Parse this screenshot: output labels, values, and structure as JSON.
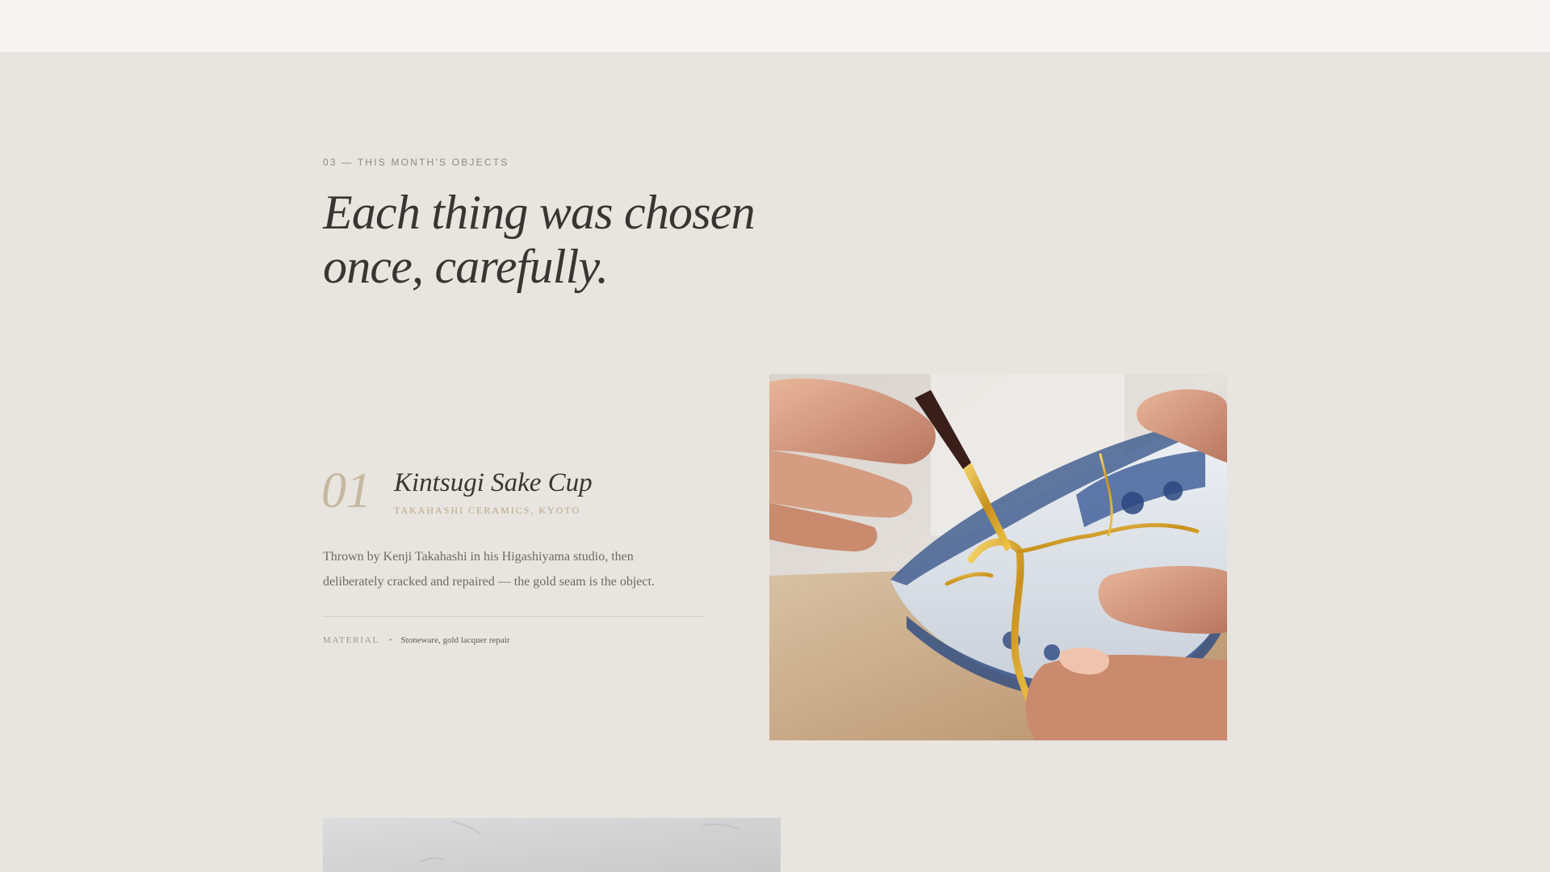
{
  "section": {
    "eyebrow": "03 — THIS MONTH'S OBJECTS",
    "headline_line1": "Each thing was chosen",
    "headline_line2": "once, carefully."
  },
  "items": [
    {
      "number": "01",
      "title": "Kintsugi Sake Cup",
      "maker": "TAKAHASHI CERAMICS, KYOTO",
      "description_line1": "Thrown by Kenji Takahashi in his Higashiyama studio, then",
      "description_line2": "deliberately cracked and repaired — the gold seam is the object.",
      "spec_label": "MATERIAL",
      "spec_separator": "•",
      "spec_value": "Stoneware, gold lacquer repair",
      "image_icon": "kintsugi-cup-photo"
    }
  ],
  "colors": {
    "page_background": "#e8e4df",
    "top_bar": "#f6f5f2",
    "accent_numeral": "#c6b89f",
    "accent_maker": "#b9a688",
    "heading": "#383632",
    "gold": "#d4a53a"
  }
}
